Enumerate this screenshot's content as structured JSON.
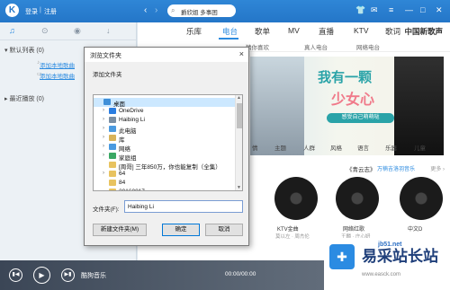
{
  "topbar": {
    "logo": "K",
    "login": "登录",
    "separator": "|",
    "register": "注册",
    "search_value": "爵欣姐 多事困",
    "icons": [
      "shirt-icon",
      "mail-icon",
      "menu-icon",
      "minimize-icon",
      "maximize-icon",
      "close-icon"
    ]
  },
  "sidebar": {
    "tabs": [
      "♫",
      "⊙",
      "◉",
      "↓"
    ],
    "playlist_default": "▾ 默认列表 (0)",
    "add_local_1": "添加本地歌曲",
    "add_local_2": "添加本地歌曲",
    "recent": "▸ 最近播放 (0)"
  },
  "main": {
    "nav": [
      "乐库",
      "电台",
      "歌单",
      "MV",
      "直播",
      "KTV",
      "歌词"
    ],
    "brand": "中国新歌声",
    "sub_nav": [
      "猜你喜欢",
      "真人电台",
      "网络电台"
    ],
    "banner": {
      "line1": "我有一颗",
      "line2": "少女心",
      "pill": "感受自己萌萌哒"
    },
    "categories": [
      "情",
      "主题",
      "人群",
      "风格",
      "语言",
      "乐器",
      "儿童"
    ],
    "section_title": "《青云志》",
    "section_link": "万楠吉洛羽音乐",
    "section_more": "更多 ›",
    "discs": [
      {
        "caption": "KTV金曲",
        "sub": "莫以左 · 周杰伦"
      },
      {
        "caption": "网络红歌",
        "sub": "王麟 · 庄心妍"
      },
      {
        "caption": "中文D",
        "sub": ""
      }
    ]
  },
  "player": {
    "song": "酷狗音乐",
    "time": "00:00/00:00"
  },
  "watermark": {
    "logo": "✚",
    "title": "易采站长站",
    "url": "www.easck.com",
    "top_text": "jb51.net"
  },
  "dialog": {
    "title": "浏览文件夹",
    "close": "×",
    "description": "添加文件夹",
    "tree": [
      {
        "label": "桌面",
        "indent": 0,
        "icon": "#3f8fd8",
        "selected": true,
        "exp": ""
      },
      {
        "label": "OneDrive",
        "indent": 1,
        "icon": "#2a7de1",
        "selected": false,
        "exp": "›"
      },
      {
        "label": "Haibing Li",
        "indent": 1,
        "icon": "#7a8ea3",
        "selected": false,
        "exp": "›"
      },
      {
        "label": "此电脑",
        "indent": 1,
        "icon": "#4a9ae0",
        "selected": false,
        "exp": "›"
      },
      {
        "label": "库",
        "indent": 1,
        "icon": "#d8b35a",
        "selected": false,
        "exp": "›"
      },
      {
        "label": "网络",
        "indent": 1,
        "icon": "#4a9ae0",
        "selected": false,
        "exp": "›"
      },
      {
        "label": "家庭组",
        "indent": 1,
        "icon": "#3aa864",
        "selected": false,
        "exp": "›"
      },
      {
        "label": "[周哥] 三年850万，你也能复制（全集）",
        "indent": 1,
        "icon": "#e8c360",
        "selected": false,
        "exp": ""
      },
      {
        "label": "64",
        "indent": 1,
        "icon": "#e8c360",
        "selected": false,
        "exp": "›"
      },
      {
        "label": "84",
        "indent": 1,
        "icon": "#e8c360",
        "selected": false,
        "exp": ""
      },
      {
        "label": "20160817",
        "indent": 1,
        "icon": "#e8c360",
        "selected": false,
        "exp": ""
      }
    ],
    "folder_label": "文件夹(F):",
    "folder_value": "Haibing Li",
    "new_folder": "新建文件夹(M)",
    "ok": "确定",
    "cancel": "取消"
  }
}
